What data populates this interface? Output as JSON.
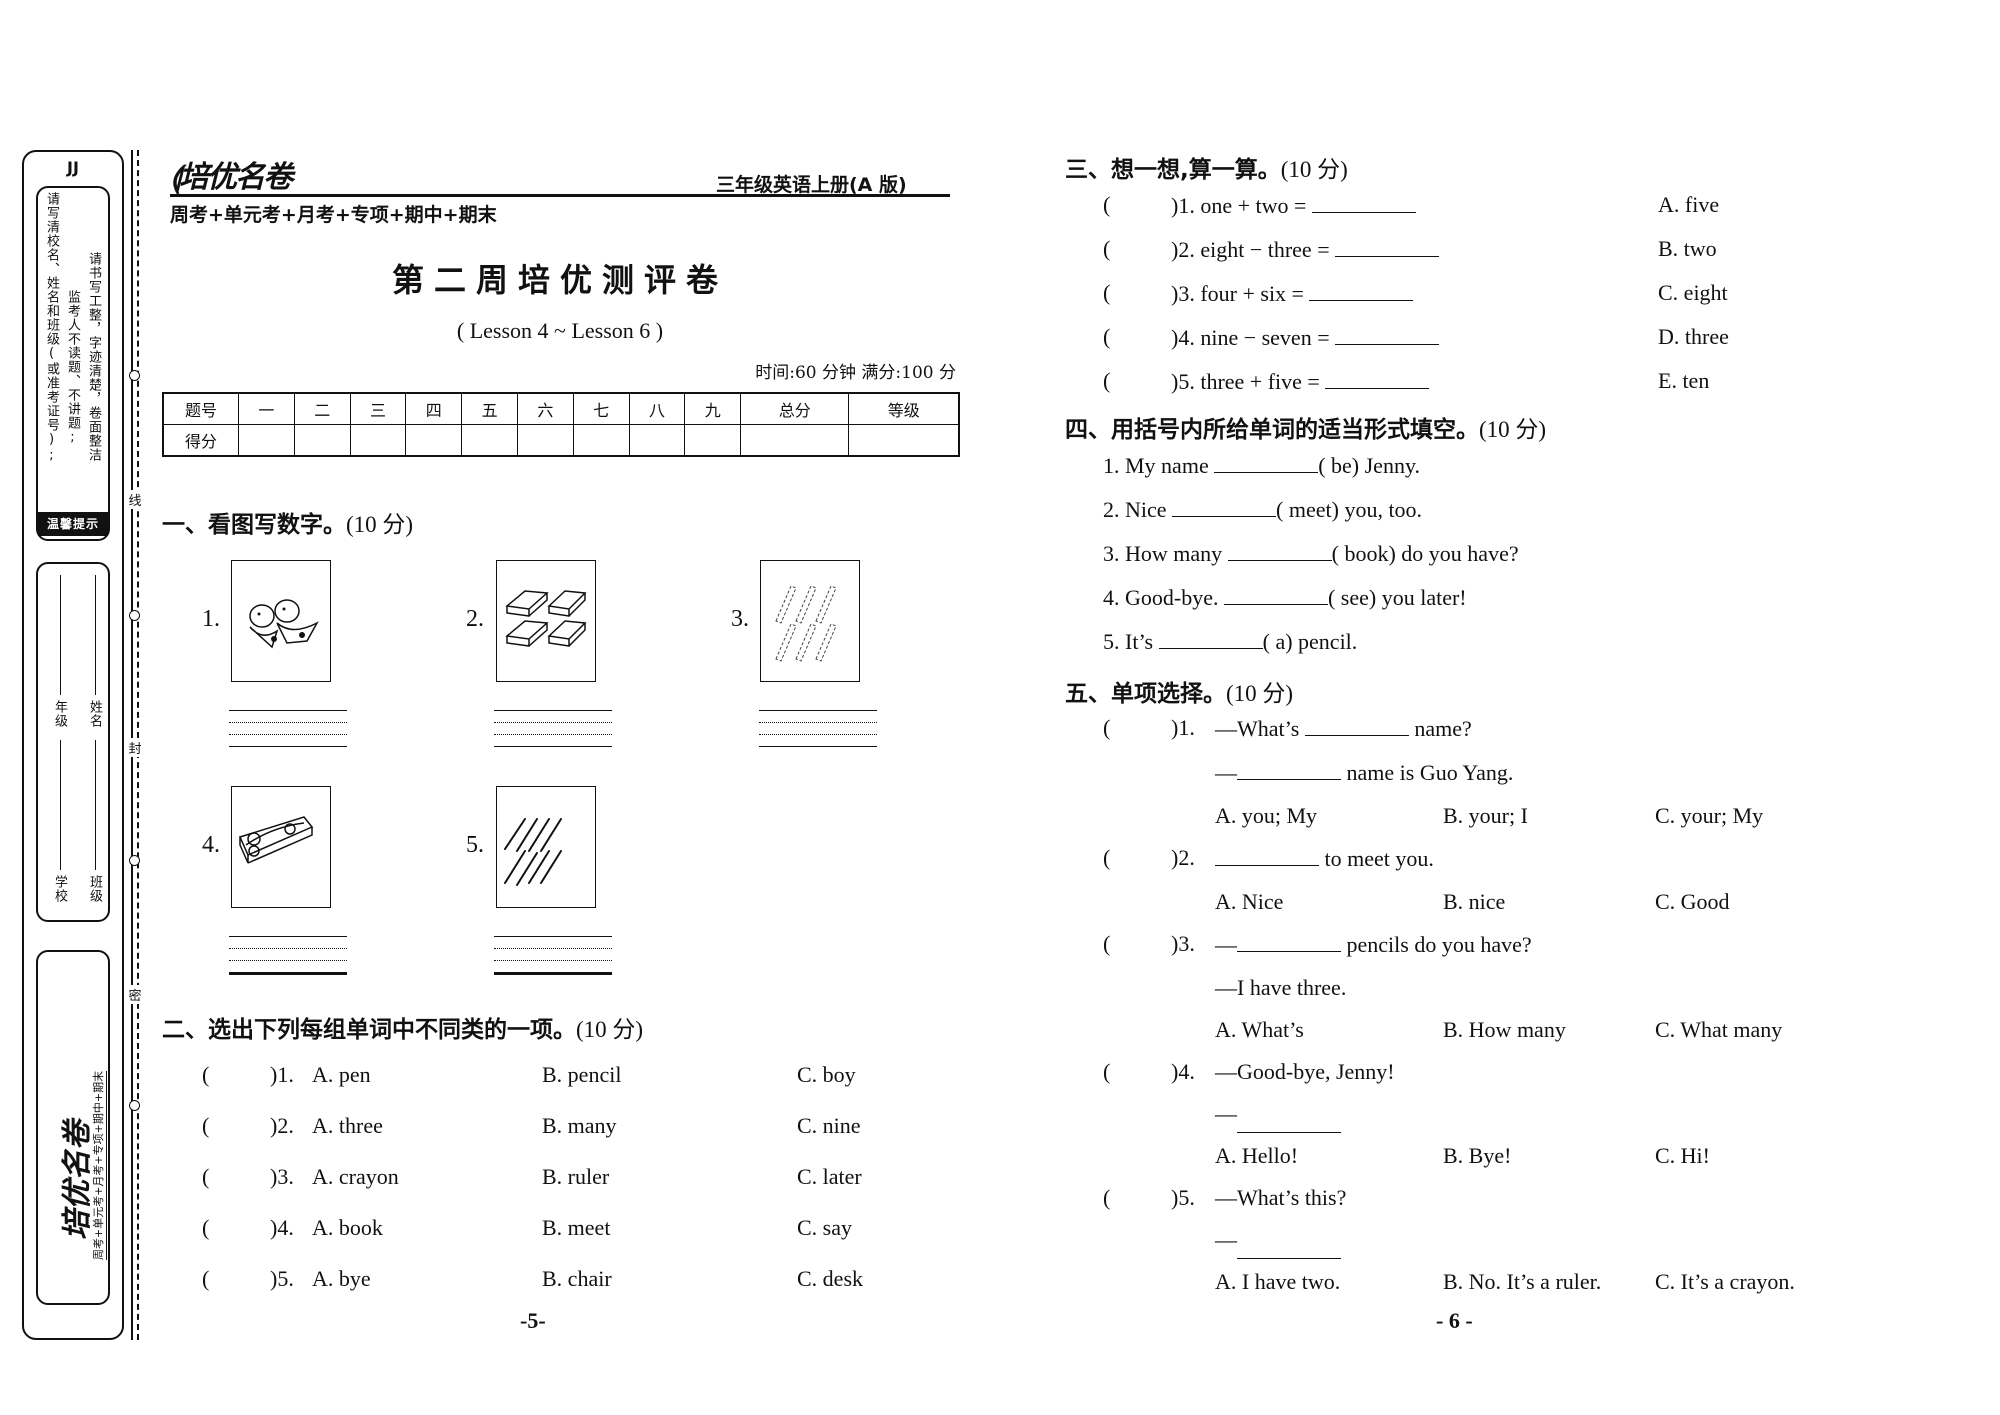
{
  "binding": {
    "edition_mark": "JJ",
    "notice_label": "温馨提示",
    "notices": [
      "请写清校名、姓名和班级(或准考证号);",
      "监考人不读题、不讲题;",
      "请书写工整，字迹清楚，卷面整洁"
    ],
    "fields": {
      "grade_label": "年级",
      "name_label": "姓名",
      "school_label": "学校",
      "class_label": "班级"
    },
    "cut_marks": [
      "线",
      "封",
      "密"
    ],
    "brand": "培优名卷",
    "brand_slogan": "周考+单元考+月考+专项+期中+期末"
  },
  "header": {
    "brand": "培优名卷",
    "series": "周考+单元考+月考+专项+期中+期末",
    "book": "三年级英语上册(A 版)",
    "title": "第二周培优测评卷",
    "lesson_range": "( Lesson 4 ~ Lesson 6 )",
    "time_info": "时间:60 分钟   满分:100 分"
  },
  "score_table": {
    "header_row": [
      "题号",
      "一",
      "二",
      "三",
      "四",
      "五",
      "六",
      "七",
      "八",
      "九",
      "总分",
      "等级"
    ],
    "score_row_label": "得分"
  },
  "section1": {
    "title": "一、看图写数字。",
    "points": "(10 分)",
    "items": [
      {
        "num": "1.",
        "picture": "two birds"
      },
      {
        "num": "2.",
        "picture": "four erasers"
      },
      {
        "num": "3.",
        "picture": "six crayons"
      },
      {
        "num": "4.",
        "picture": "one pencil box"
      },
      {
        "num": "5.",
        "picture": "eight pencils"
      }
    ]
  },
  "section2": {
    "title": "二、选出下列每组单词中不同类的一项。",
    "points": "(10 分)",
    "rows": [
      {
        "num": ")1.",
        "a": "A. pen",
        "b": "B. pencil",
        "c": "C. boy"
      },
      {
        "num": ")2.",
        "a": "A. three",
        "b": "B. many",
        "c": "C. nine"
      },
      {
        "num": ")3.",
        "a": "A. crayon",
        "b": "B. ruler",
        "c": "C. later"
      },
      {
        "num": ")4.",
        "a": "A. book",
        "b": "B. meet",
        "c": "C. say"
      },
      {
        "num": ")5.",
        "a": "A. bye",
        "b": "B. chair",
        "c": "C. desk"
      }
    ]
  },
  "page_left": "-5-",
  "section3": {
    "title": "三、想一想,算一算。",
    "points": "(10 分)",
    "rows": [
      {
        "q": ")1. one + two =",
        "opt": "A. five"
      },
      {
        "q": ")2. eight − three =",
        "opt": "B. two"
      },
      {
        "q": ")3. four + six =",
        "opt": "C. eight"
      },
      {
        "q": ")4. nine − seven =",
        "opt": "D. three"
      },
      {
        "q": ")5. three + five =",
        "opt": "E. ten"
      }
    ]
  },
  "section4": {
    "title": "四、用括号内所给单词的适当形式填空。",
    "points": "(10 分)",
    "rows": [
      {
        "pre": "1. My name",
        "post": "( be)  Jenny."
      },
      {
        "pre": "2. Nice",
        "post": "( meet)  you, too."
      },
      {
        "pre": "3. How many",
        "post": "( book)  do you have?"
      },
      {
        "pre": "4. Good-bye.",
        "post": "( see)  you later!"
      },
      {
        "pre": "5. It’s",
        "post": "( a)  pencil."
      }
    ]
  },
  "section5": {
    "title": "五、单项选择。",
    "points": "(10 分)",
    "questions": [
      {
        "num": ")1.",
        "line1_pre": "—What’s",
        "line1_post": "name?",
        "line2_pre": "—",
        "line2_post": "name is Guo Yang.",
        "options": [
          "A. you; My",
          "B. your; I",
          "C. your; My"
        ]
      },
      {
        "num": ")2.",
        "line1_pre": "",
        "line1_post": "to meet you.",
        "options": [
          "A. Nice",
          "B. nice",
          "C. Good"
        ]
      },
      {
        "num": ")3.",
        "line1_pre": "—",
        "line1_post": "pencils do you have?",
        "line2": "—I have three.",
        "options": [
          "A. What’s",
          "B. How many",
          "C. What many"
        ]
      },
      {
        "num": ")4.",
        "line1": "—Good-bye, Jenny!",
        "line2_pre": "—",
        "options": [
          "A. Hello!",
          "B. Bye!",
          "C. Hi!"
        ]
      },
      {
        "num": ")5.",
        "line1": "—What’s this?",
        "line2_pre": "—",
        "options": [
          "A. I have two.",
          "B. No. It’s a ruler.",
          "C. It’s a crayon."
        ]
      }
    ]
  },
  "page_right": "- 6 -"
}
